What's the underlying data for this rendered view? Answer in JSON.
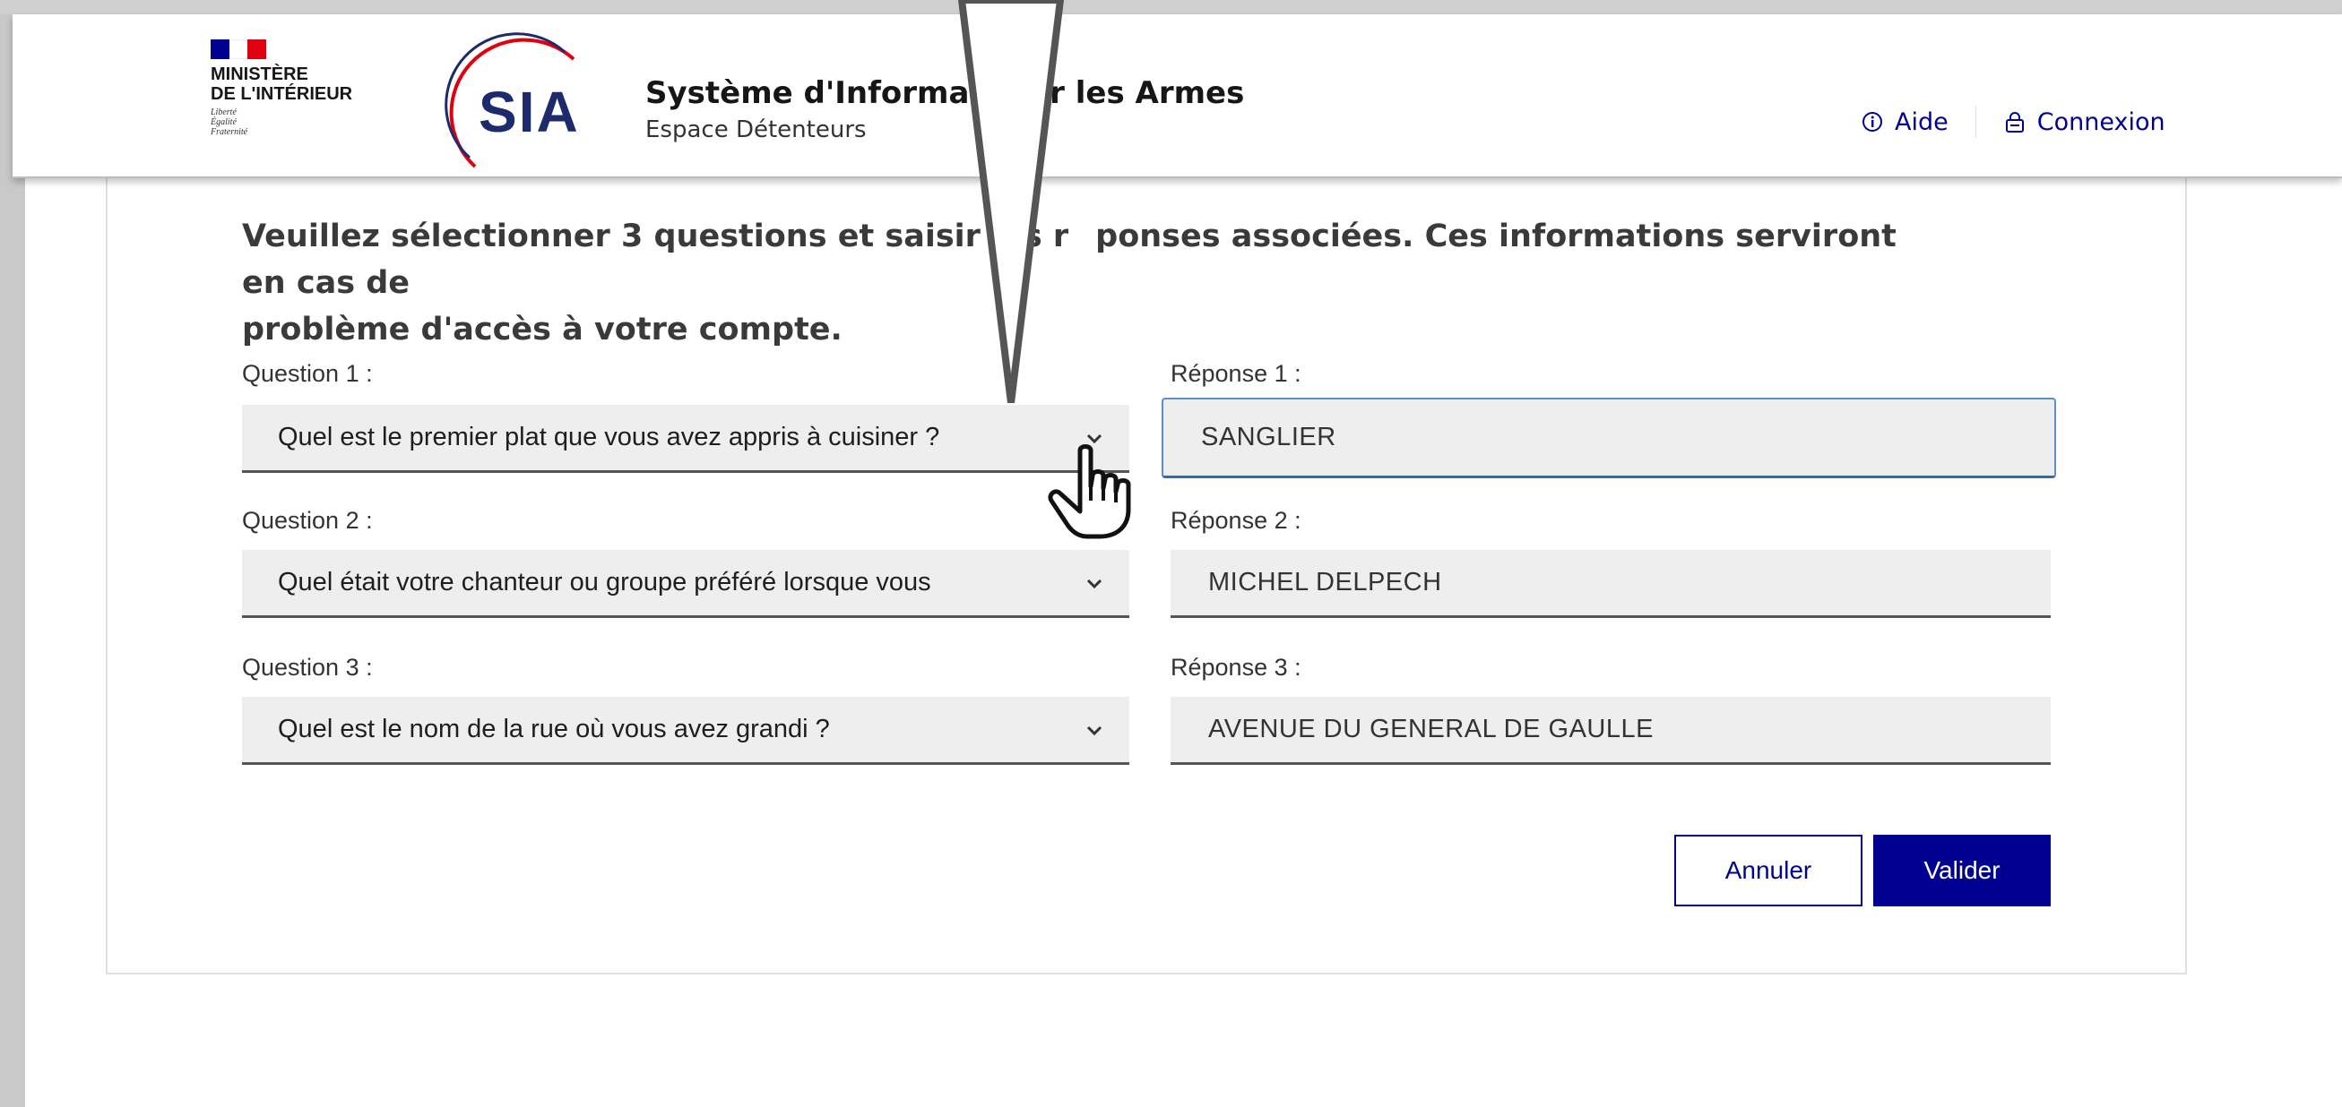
{
  "header": {
    "ministry_line1": "MINISTÈRE",
    "ministry_line2": "DE L'INTÉRIEUR",
    "motto": [
      "Liberté",
      "Égalité",
      "Fraternité"
    ],
    "logo_text": "SIA",
    "app_title": "Système d'Informatic",
    "app_title_end": "ır les Armes",
    "app_subtitle": "Espace Détenteurs",
    "links": [
      {
        "label": "Aide",
        "icon": "info-icon"
      },
      {
        "label": "Connexion",
        "icon": "lock-icon"
      }
    ]
  },
  "form": {
    "instructions_part1": "Veuillez sélectionner 3 questions et saisir les r",
    "instructions_part2": "ponses associées. Ces informations serviront en cas de",
    "instructions_line2": "problème d'accès à votre compte.",
    "rows": [
      {
        "question_label": "Question 1 :",
        "question_value": "Quel est le premier plat que vous avez appris à cuisiner ?",
        "answer_label": "Réponse 1 :",
        "answer_value": "SANGLIER"
      },
      {
        "question_label": "Question 2 :",
        "question_value": "Quel était votre chanteur ou groupe préféré lorsque vous",
        "answer_label": "Réponse 2 :",
        "answer_value": "MICHEL DELPECH"
      },
      {
        "question_label": "Question 3 :",
        "question_value": "Quel est le nom de la rue où vous avez grandi ?",
        "answer_label": "Réponse 3 :",
        "answer_value": "AVENUE DU GENERAL DE GAULLE"
      }
    ],
    "cancel_label": "Annuler",
    "validate_label": "Valider"
  },
  "colors": {
    "primary": "#000091",
    "flag_red": "#e1000f",
    "focus_border": "#5b8fc7"
  }
}
